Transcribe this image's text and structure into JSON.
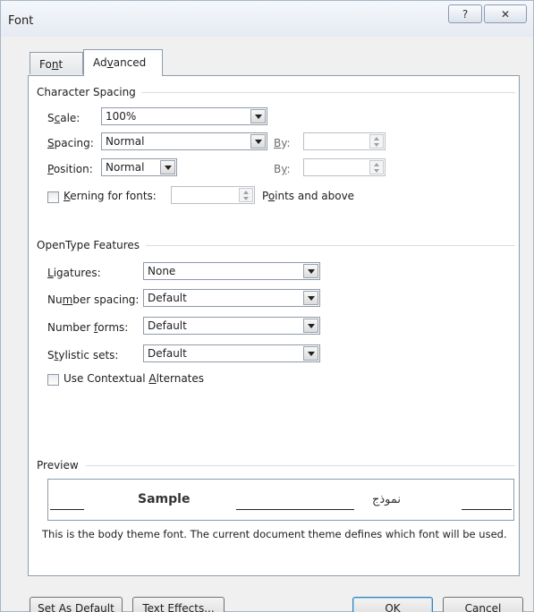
{
  "window": {
    "title": "Font",
    "help_glyph": "?",
    "close_glyph": "✕"
  },
  "tabs": [
    {
      "pre": "Fo",
      "key": "n",
      "post": "t"
    },
    {
      "pre": "Ad",
      "key": "v",
      "post": "anced"
    }
  ],
  "character_spacing": {
    "heading": "Character Spacing",
    "scale": {
      "pre": "S",
      "key": "c",
      "post": "ale:",
      "value": "100%"
    },
    "spacing": {
      "pre": "",
      "key": "S",
      "post": "pacing:",
      "value": "Normal",
      "by_pre": "",
      "by_key": "B",
      "by_post": "y:"
    },
    "position": {
      "pre": "",
      "key": "P",
      "post": "osition:",
      "value": "Normal",
      "by_pre": "B",
      "by_key": "y",
      "by_post": ":"
    },
    "kerning": {
      "pre": "",
      "key": "K",
      "post": "erning for fonts:",
      "suffix_pre": "P",
      "suffix_key": "o",
      "suffix_post": "ints and above"
    }
  },
  "opentype": {
    "heading": "OpenType Features",
    "ligatures": {
      "pre": "",
      "key": "L",
      "post": "igatures:",
      "value": "None"
    },
    "number_spacing": {
      "pre": "Nu",
      "key": "m",
      "post": "ber spacing:",
      "value": "Default"
    },
    "number_forms": {
      "pre": "Number ",
      "key": "f",
      "post": "orms:",
      "value": "Default"
    },
    "stylistic_sets": {
      "pre": "S",
      "key": "t",
      "post": "ylistic sets:",
      "value": "Default"
    },
    "contextual": {
      "pre": "Use Contextual ",
      "key": "A",
      "post": "lternates"
    }
  },
  "preview": {
    "heading": "Preview",
    "sample": "Sample",
    "arabic_sample": "نموذج",
    "description": "This is the body theme font. The current document theme defines which font will be used."
  },
  "buttons": {
    "set_default": "Set As Default",
    "text_effects": "Text Effects...",
    "ok": "OK",
    "cancel": "Cancel"
  }
}
